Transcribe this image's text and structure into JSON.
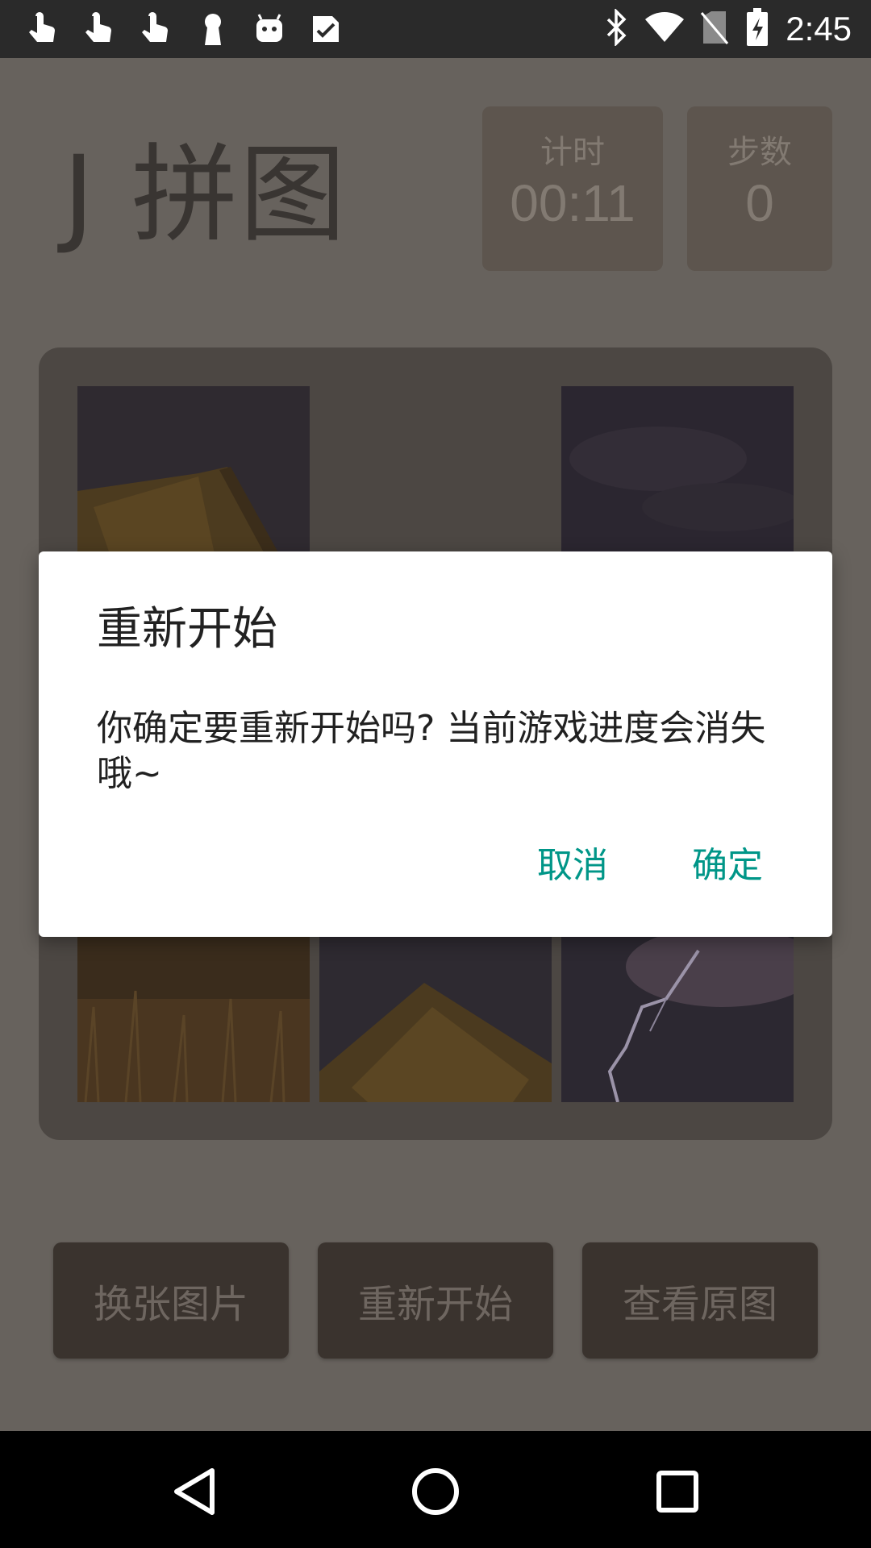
{
  "status_bar": {
    "time": "2:45",
    "left_icons": [
      "touch-app-icon",
      "touch-app-icon",
      "touch-app-icon",
      "keyhole-icon",
      "android-icon",
      "check-box-icon"
    ],
    "right_icons": [
      "bluetooth-icon",
      "wifi-icon",
      "no-sim-icon",
      "battery-charging-icon"
    ]
  },
  "app": {
    "title": "J 拼图",
    "timer": {
      "label": "计时",
      "value": "00:11"
    },
    "steps": {
      "label": "步数",
      "value": "0"
    },
    "buttons": {
      "change_image": "换张图片",
      "restart": "重新开始",
      "view_original": "查看原图"
    }
  },
  "dialog": {
    "title": "重新开始",
    "message": "你确定要重新开始吗? 当前游戏进度会消失哦~",
    "cancel": "取消",
    "confirm": "确定"
  },
  "colors": {
    "accent": "#009688",
    "background_dimmed": "#67625d",
    "board": "#4c4743",
    "button": "#3a332e"
  }
}
